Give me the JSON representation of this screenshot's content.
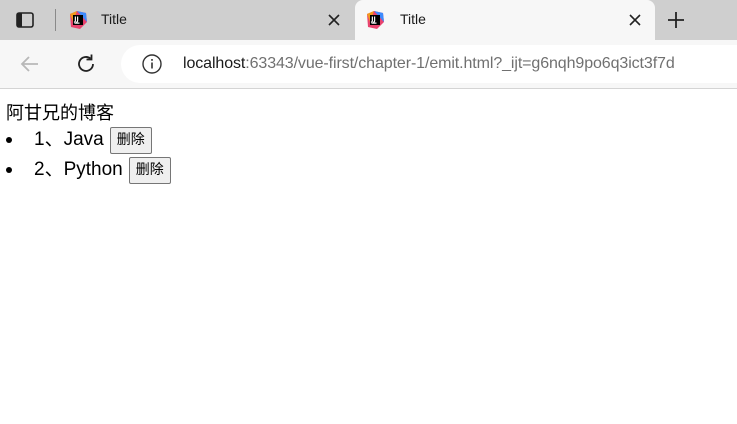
{
  "browser": {
    "tabs": [
      {
        "title": "Title",
        "active": false
      },
      {
        "title": "Title",
        "active": true
      }
    ],
    "url_host": "localhost",
    "url_rest": ":63343/vue-first/chapter-1/emit.html?_ijt=g6nqh9po6q3ict3f7d",
    "icons": {
      "sidebar": "sidebar-panel-icon",
      "favicon": "jetbrains-favicon-icon",
      "close": "close-icon",
      "new_tab": "plus-icon",
      "back": "back-arrow-icon",
      "reload": "reload-icon",
      "info": "info-icon"
    }
  },
  "page": {
    "title": "阿甘兄的博客",
    "posts": [
      {
        "text": "1、Java",
        "delete_label": "删除"
      },
      {
        "text": "2、Python",
        "delete_label": "删除"
      }
    ]
  }
}
